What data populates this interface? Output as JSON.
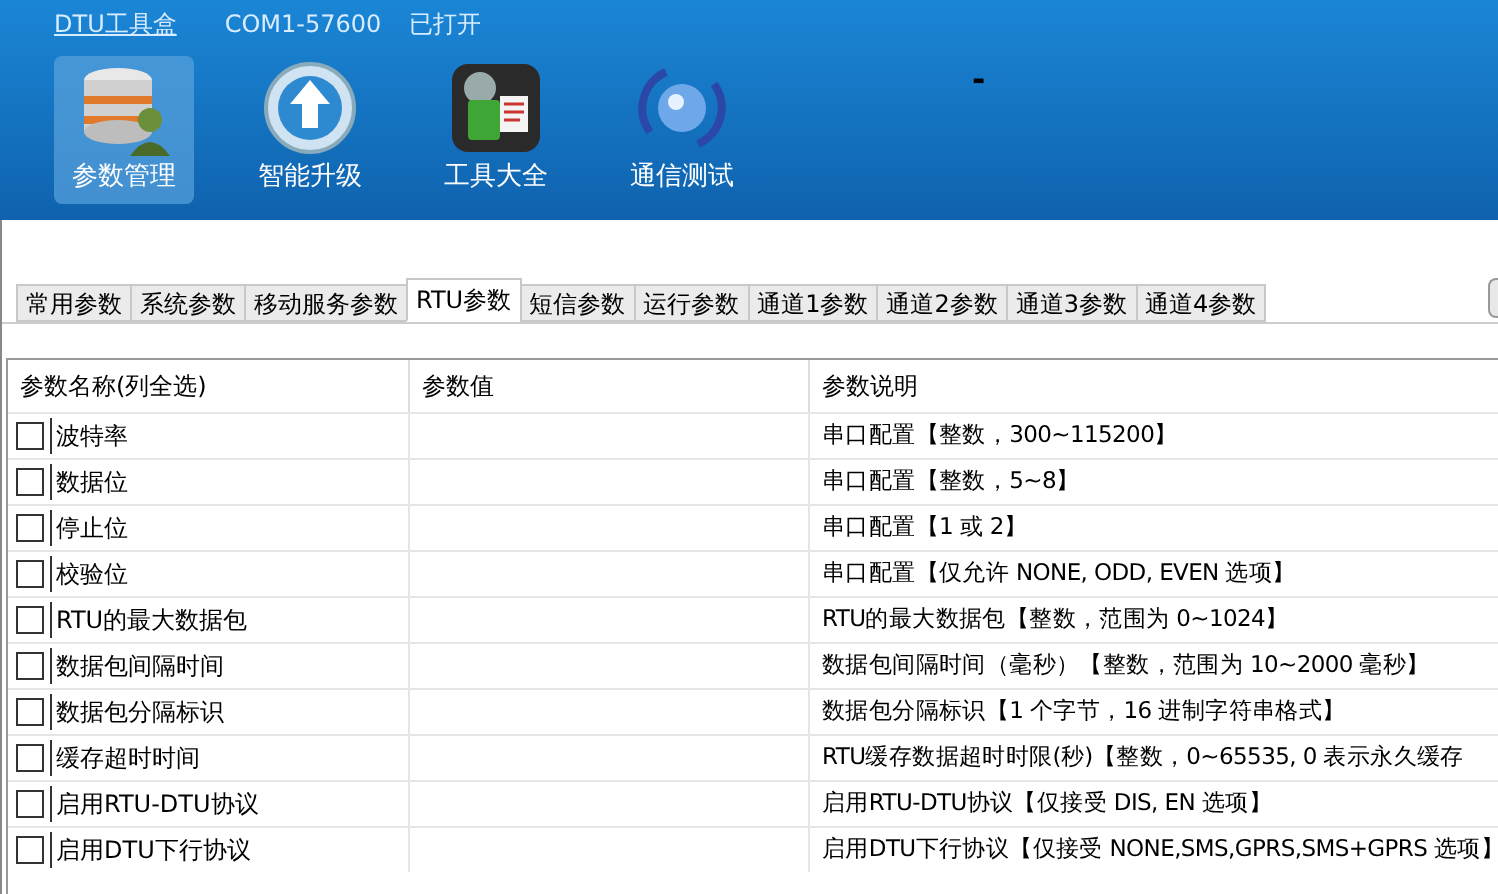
{
  "window": {
    "title": "DTU工具盒",
    "port": "COM1-57600",
    "status": "已打开",
    "minimize": "-"
  },
  "toolbar": [
    {
      "kind": "params",
      "label": "参数管理",
      "selected": true
    },
    {
      "kind": "upgrade",
      "label": "智能升级",
      "selected": false
    },
    {
      "kind": "tools",
      "label": "工具大全",
      "selected": false
    },
    {
      "kind": "comm",
      "label": "通信测试",
      "selected": false
    }
  ],
  "tabs": [
    {
      "label": "常用参数",
      "selected": false
    },
    {
      "label": "系统参数",
      "selected": false
    },
    {
      "label": "移动服务参数",
      "selected": false
    },
    {
      "label": "RTU参数",
      "selected": true
    },
    {
      "label": "短信参数",
      "selected": false
    },
    {
      "label": "运行参数",
      "selected": false
    },
    {
      "label": "通道1参数",
      "selected": false
    },
    {
      "label": "通道2参数",
      "selected": false
    },
    {
      "label": "通道3参数",
      "selected": false
    },
    {
      "label": "通道4参数",
      "selected": false
    }
  ],
  "table": {
    "columns": [
      "参数名称(列全选)",
      "参数值",
      "参数说明"
    ],
    "rows": [
      {
        "name": "波特率",
        "checked": false,
        "description": "串口配置【整数，300~115200】"
      },
      {
        "name": "数据位",
        "checked": false,
        "description": "串口配置【整数，5~8】"
      },
      {
        "name": "停止位",
        "checked": false,
        "description": "串口配置【1 或 2】"
      },
      {
        "name": "校验位",
        "checked": false,
        "description": "串口配置【仅允许 NONE, ODD, EVEN 选项】"
      },
      {
        "name": "RTU的最大数据包",
        "checked": false,
        "description": "RTU的最大数据包【整数，范围为 0~1024】"
      },
      {
        "name": "数据包间隔时间",
        "checked": false,
        "description": "数据包间隔时间（毫秒）【整数，范围为 10~2000 毫秒】"
      },
      {
        "name": "数据包分隔标识",
        "checked": false,
        "description": "数据包分隔标识【1 个字节，16 进制字符串格式】"
      },
      {
        "name": "缓存超时时间",
        "checked": false,
        "description": "RTU缓存数据超时时限(秒)【整数，0~65535, 0 表示永久缓存"
      },
      {
        "name": "启用RTU-DTU协议",
        "checked": false,
        "description": "启用RTU-DTU协议【仅接受 DIS, EN 选项】"
      },
      {
        "name": "启用DTU下行协议",
        "checked": false,
        "description": "启用DTU下行协议【仅接受 NONE,SMS,GPRS,SMS+GPRS 选项】"
      }
    ]
  }
}
